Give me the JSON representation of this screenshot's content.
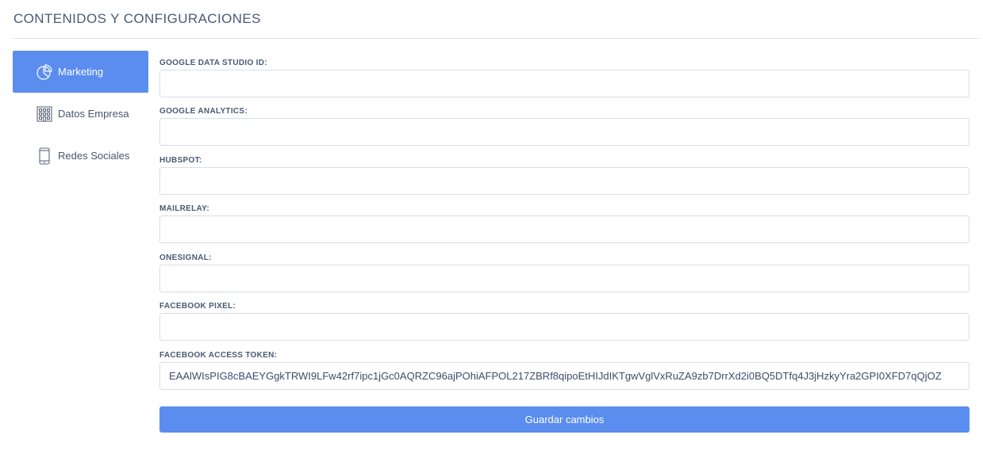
{
  "page": {
    "title": "CONTENIDOS Y CONFIGURACIONES"
  },
  "sidebar": {
    "items": [
      {
        "label": "Marketing",
        "icon": "pie-chart-icon",
        "active": true
      },
      {
        "label": "Datos Empresa",
        "icon": "building-icon",
        "active": false
      },
      {
        "label": "Redes Sociales",
        "icon": "mobile-phone-icon",
        "active": false
      }
    ]
  },
  "form": {
    "fields": [
      {
        "label": "GOOGLE DATA STUDIO ID:",
        "value": ""
      },
      {
        "label": "GOOGLE ANALYTICS:",
        "value": ""
      },
      {
        "label": "HUBSPOT:",
        "value": ""
      },
      {
        "label": "MAILRELAY:",
        "value": ""
      },
      {
        "label": "ONESIGNAL:",
        "value": ""
      },
      {
        "label": "FACEBOOK PIXEL:",
        "value": ""
      },
      {
        "label": "FACEBOOK ACCESS TOKEN:",
        "value": "EAAlWIsPIG8cBAEYGgkTRWI9LFw42rf7ipc1jGc0AQRZC96ajPOhiAFPOL217ZBRf8qipoEtHIJdIKTgwVglVxRuZA9zb7DrrXd2i0BQ5DTfq4J3jHzkyYra2GPI0XFD7qQjOZ"
      }
    ],
    "save_label": "Guardar cambios"
  },
  "colors": {
    "accent": "#5b8def",
    "text": "#4a5a73",
    "border": "#d9dde3"
  }
}
